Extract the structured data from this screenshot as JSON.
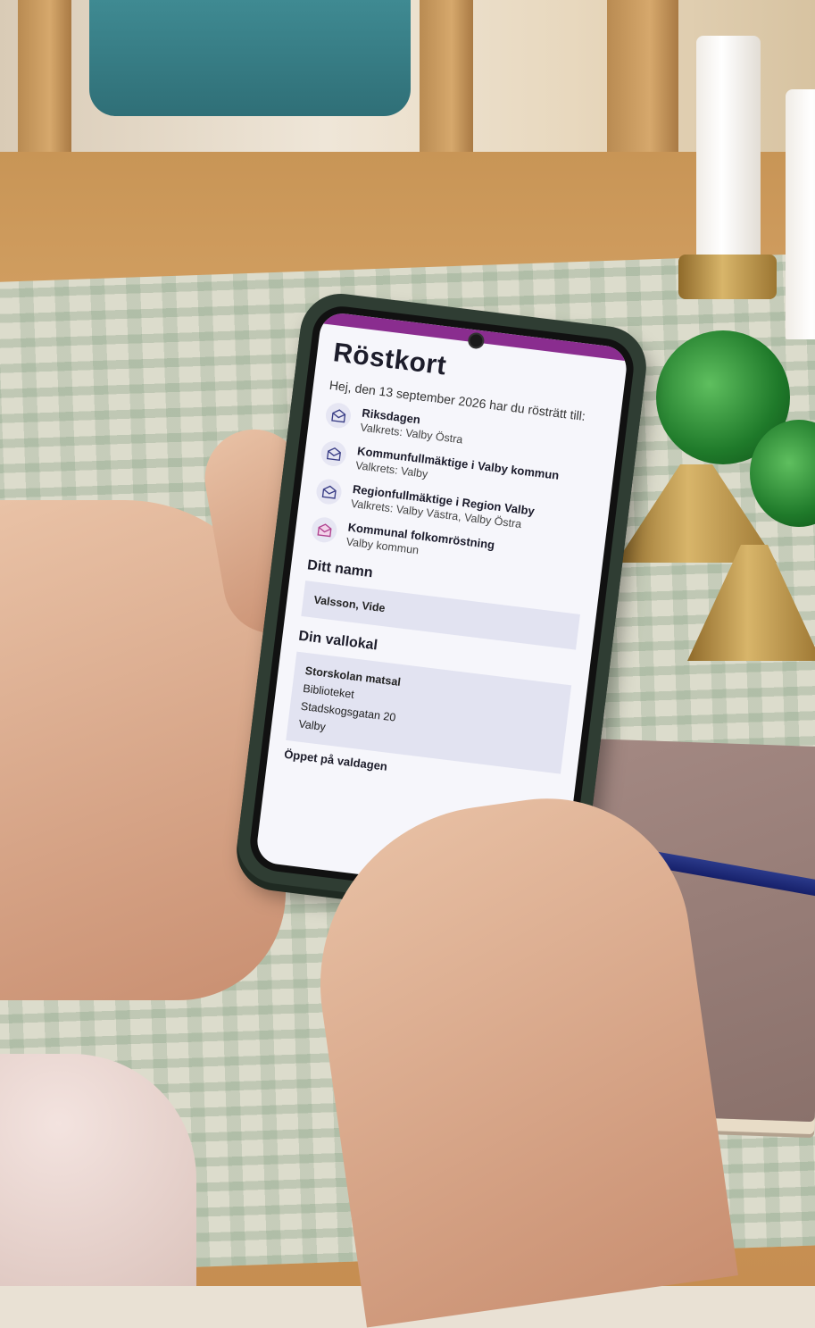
{
  "app": {
    "title": "Röstkort",
    "intro": "Hej, den 13 september 2026 har du rösträtt till:",
    "elections": [
      {
        "name": "Riksdagen",
        "detail": "Valkrets: Valby Östra",
        "icon": "envelope-icon",
        "icon_color": "#3b3f87"
      },
      {
        "name": "Kommunfullmäktige i Valby kommun",
        "detail": "Valkrets: Valby",
        "icon": "envelope-icon",
        "icon_color": "#3b3f87"
      },
      {
        "name": "Regionfullmäktige i Region Valby",
        "detail": "Valkrets: Valby Västra, Valby Östra",
        "icon": "envelope-icon",
        "icon_color": "#3b3f87"
      },
      {
        "name": "Kommunal folkomröstning",
        "detail": "Valby kommun",
        "icon": "envelope-pink-icon",
        "icon_color": "#b0428f"
      }
    ],
    "name_section": {
      "heading": "Ditt namn",
      "value": "Valsson, Vide"
    },
    "polling_section": {
      "heading": "Din vallokal",
      "place": "Storskolan matsal",
      "room": "Biblioteket",
      "street": "Stadskogsgatan 20",
      "city": "Valby"
    },
    "open_heading": "Öppet på valdagen"
  },
  "colors": {
    "accent_bar": "#8a2d8f",
    "box_bg": "#e2e3f1",
    "icon_bg": "#e6e6f3"
  }
}
